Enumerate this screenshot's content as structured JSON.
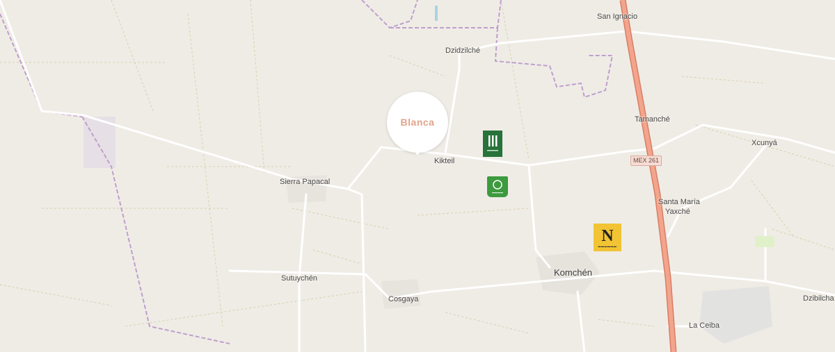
{
  "map": {
    "places": {
      "san_ignacio": "San Ignacio",
      "dzidzilche": "Dzidzilché",
      "tamanche": "Tamanché",
      "xcunya": "Xcunyá",
      "kikteil": "Kikteil",
      "sierra_papacal": "Sierra Papacal",
      "santa_maria_yaxche_1": "Santa María",
      "santa_maria_yaxche_2": "Yaxché",
      "sutuychen": "Sutuychén",
      "komchen": "Komchén",
      "cosgaya": "Cosgaya",
      "dzibilchaltun": "Dzibilcha",
      "la_ceiba": "La Ceiba"
    },
    "road_shield": "MEX 261",
    "pin_label": "Blanca",
    "markers": [
      {
        "id": "jardines",
        "icon": "bars-logo-icon",
        "color": "#27733a"
      },
      {
        "id": "la-reserva",
        "icon": "circle-logo-icon",
        "color": "#3d9a3e"
      },
      {
        "id": "n-logo",
        "icon": "letter-n-logo-icon",
        "color": "#f2c433"
      }
    ],
    "colors": {
      "background": "#efece6",
      "highway": "#f2a58c",
      "boundary": "#b896c8",
      "road": "#ffffff"
    }
  }
}
